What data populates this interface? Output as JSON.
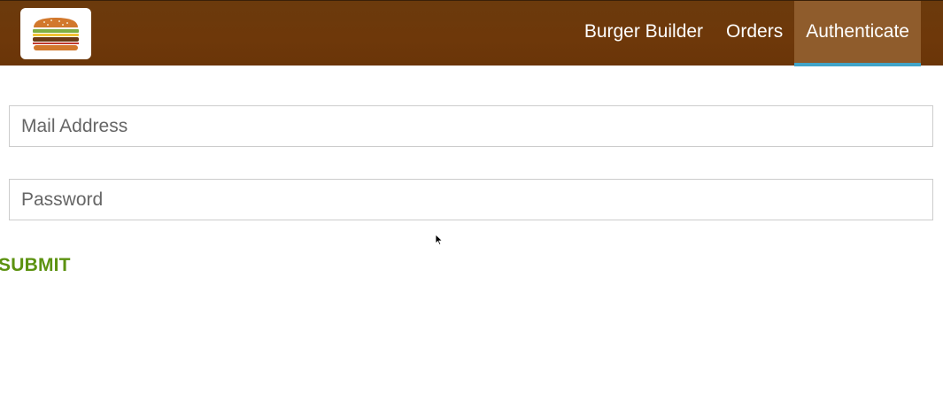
{
  "toolbar": {
    "logo_icon": "burger-logo-icon",
    "nav_items": [
      {
        "label": "Burger Builder",
        "active": false
      },
      {
        "label": "Orders",
        "active": false
      },
      {
        "label": "Authenticate",
        "active": true
      }
    ]
  },
  "form": {
    "email": {
      "placeholder": "Mail Address",
      "value": ""
    },
    "password": {
      "placeholder": "Password",
      "value": ""
    },
    "submit_label": "SUBMIT"
  },
  "colors": {
    "toolbar_bg": "#703b09",
    "active_nav_bg": "#8f5c2c",
    "active_nav_underline": "#40a4c8",
    "submit_text": "#5c9210"
  }
}
